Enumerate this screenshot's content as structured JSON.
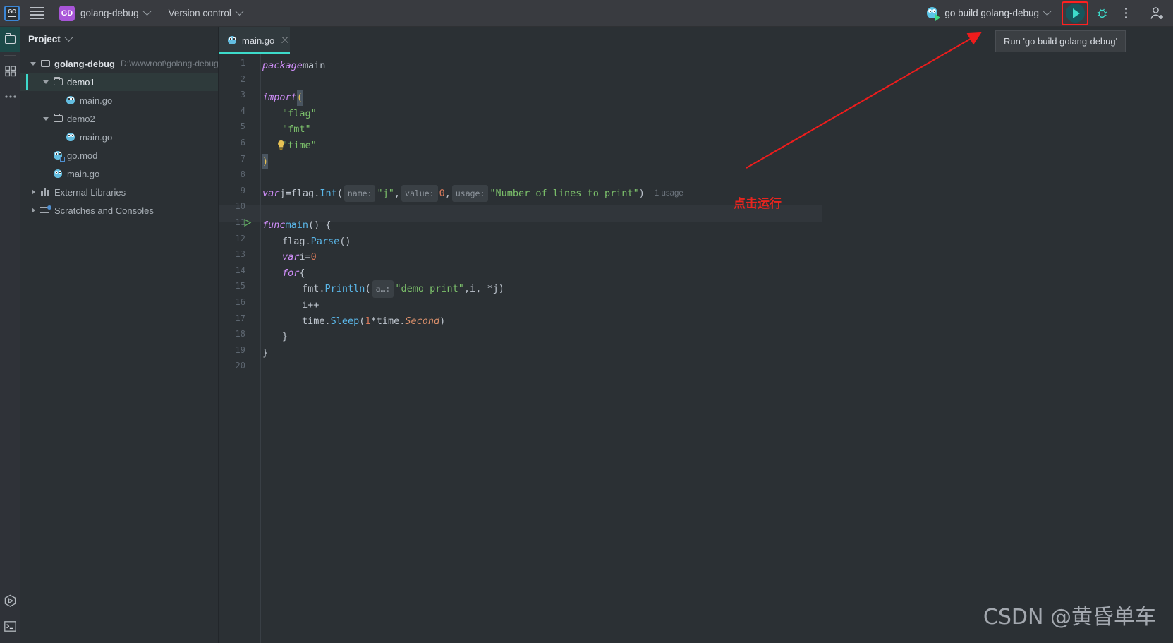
{
  "toolbar": {
    "app_logo": "go-logo",
    "menu_icon": "hamburger-menu-icon",
    "project_badge": "GD",
    "project_name": "golang-debug",
    "version_control": "Version control",
    "run_config_name": "go build golang-debug",
    "run_icon": "run-play-icon",
    "debug_icon": "debug-bug-icon",
    "more_icon": "more-vertical-icon",
    "account_icon": "add-user-icon"
  },
  "tooltip": {
    "text": "Run 'go build golang-debug'"
  },
  "rail": {
    "top": [
      {
        "name": "project-folder-icon",
        "active": true
      },
      {
        "name": "structure-grid-icon",
        "active": false
      },
      {
        "name": "more-dots-icon",
        "active": false
      }
    ],
    "bottom": [
      {
        "name": "run-hexagon-icon"
      },
      {
        "name": "terminal-icon"
      }
    ]
  },
  "project_panel": {
    "title": "Project",
    "tree": [
      {
        "depth": 0,
        "arrow": "down",
        "icon": "folder-icon",
        "label": "golang-debug",
        "bold": true,
        "path": "D:\\wwwroot\\golang-debug",
        "selected": false
      },
      {
        "depth": 1,
        "arrow": "down",
        "icon": "folder-icon",
        "label": "demo1",
        "bold": false,
        "white": true,
        "path": "",
        "selected": true
      },
      {
        "depth": 2,
        "arrow": "none",
        "icon": "go-file-icon",
        "label": "main.go",
        "bold": false,
        "path": "",
        "selected": false
      },
      {
        "depth": 1,
        "arrow": "down",
        "icon": "folder-icon",
        "label": "demo2",
        "bold": false,
        "path": "",
        "selected": false
      },
      {
        "depth": 2,
        "arrow": "none",
        "icon": "go-file-icon",
        "label": "main.go",
        "bold": false,
        "path": "",
        "selected": false
      },
      {
        "depth": 1,
        "arrow": "none",
        "icon": "go-mod-icon",
        "label": "go.mod",
        "bold": false,
        "path": "",
        "selected": false
      },
      {
        "depth": 1,
        "arrow": "none",
        "icon": "go-file-icon",
        "label": "main.go",
        "bold": false,
        "path": "",
        "selected": false
      },
      {
        "depth": 0,
        "arrow": "right",
        "icon": "library-icon",
        "label": "External Libraries",
        "bold": false,
        "path": "",
        "selected": false
      },
      {
        "depth": 0,
        "arrow": "right",
        "icon": "scratches-icon",
        "label": "Scratches and Consoles",
        "bold": false,
        "path": "",
        "selected": false
      }
    ]
  },
  "editor": {
    "tab": {
      "label": "main.go",
      "icon": "go-file-icon",
      "close_icon": "close-icon"
    },
    "current_line": 7,
    "gutter_run_line": 11,
    "bulb_line": 6,
    "line_numbers": [
      1,
      2,
      3,
      4,
      5,
      6,
      7,
      8,
      9,
      10,
      11,
      12,
      13,
      14,
      15,
      16,
      17,
      18,
      19,
      20
    ],
    "lines": [
      {
        "n": 1,
        "text": "package main"
      },
      {
        "n": 2,
        "text": ""
      },
      {
        "n": 3,
        "text": "import ("
      },
      {
        "n": 4,
        "text": "    \"flag\""
      },
      {
        "n": 5,
        "text": "    \"fmt\""
      },
      {
        "n": 6,
        "text": "    \"time\""
      },
      {
        "n": 7,
        "text": ")"
      },
      {
        "n": 8,
        "text": ""
      },
      {
        "n": 9,
        "text": "var j = flag.Int( name: \"j\", value: 0, usage: \"Number of lines to print\")"
      },
      {
        "n": 10,
        "text": ""
      },
      {
        "n": 11,
        "text": "func main() {"
      },
      {
        "n": 12,
        "text": "    flag.Parse()"
      },
      {
        "n": 13,
        "text": "    var i = 0"
      },
      {
        "n": 14,
        "text": "    for {"
      },
      {
        "n": 15,
        "text": "        fmt.Println( a...: \"demo print\", i, *j)"
      },
      {
        "n": 16,
        "text": "        i++"
      },
      {
        "n": 17,
        "text": "        time.Sleep(1 * time.Second)"
      },
      {
        "n": 18,
        "text": "    }"
      },
      {
        "n": 19,
        "text": "}"
      },
      {
        "n": 20,
        "text": ""
      }
    ],
    "param_hints": {
      "name": "name:",
      "value": "value:",
      "usage": "usage:",
      "args": "a…:"
    },
    "usage_label": "1 usage"
  },
  "annotations": {
    "callout_text": "点击运行",
    "arrow_color": "#ee1c1c",
    "highlight_color": "#ff2020"
  },
  "watermark": {
    "text": "CSDN @黄昏单车"
  },
  "colors": {
    "background": "#2b3034",
    "toolbar": "#393b40",
    "accent_teal": "#3ddbcb",
    "selection": "#2e3a3b",
    "keyword": "#cf8ef8",
    "string": "#7bbf6a",
    "function": "#5ab6e8",
    "number": "#d97a5b",
    "badge_purple": "#a855d8"
  }
}
